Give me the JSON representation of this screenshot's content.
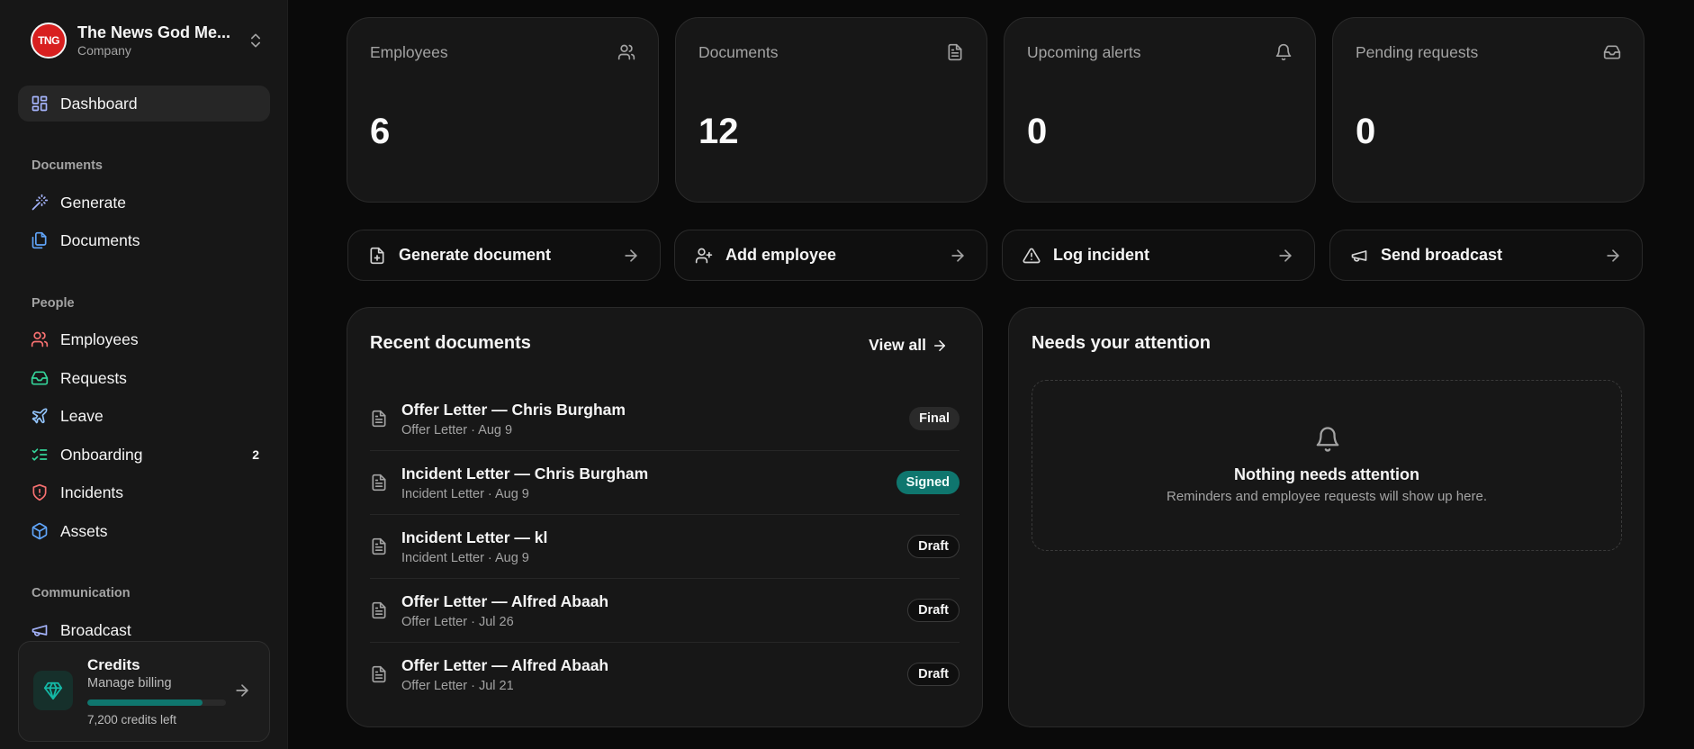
{
  "company": {
    "logo_text": "TNG",
    "name": "The News God Me...",
    "type": "Company"
  },
  "sidebar": {
    "active": {
      "label": "Dashboard",
      "icon": "layout-grid-icon"
    },
    "sections": [
      {
        "title": "Documents",
        "items": [
          {
            "label": "Generate",
            "icon": "magic-wand-icon",
            "color": "#a5b4fc"
          },
          {
            "label": "Documents",
            "icon": "files-icon",
            "color": "#60a5fa"
          }
        ]
      },
      {
        "title": "People",
        "items": [
          {
            "label": "Employees",
            "icon": "users-icon",
            "color": "#f87171"
          },
          {
            "label": "Requests",
            "icon": "inbox-icon",
            "color": "#34d399"
          },
          {
            "label": "Leave",
            "icon": "plane-icon",
            "color": "#93c5fd"
          },
          {
            "label": "Onboarding",
            "icon": "list-checks-icon",
            "color": "#34d399",
            "badge": "2"
          },
          {
            "label": "Incidents",
            "icon": "shield-alert-icon",
            "color": "#f87171"
          },
          {
            "label": "Assets",
            "icon": "box-icon",
            "color": "#60a5fa"
          }
        ]
      },
      {
        "title": "Communication",
        "items": [
          {
            "label": "Broadcast",
            "icon": "megaphone-icon",
            "color": "#a5b4fc"
          }
        ]
      }
    ]
  },
  "credits": {
    "title": "Credits",
    "subtitle": "Manage billing",
    "remaining": "7,200 credits left",
    "progress": 0.83
  },
  "stats": [
    {
      "label": "Employees",
      "value": "6",
      "icon": "users-icon"
    },
    {
      "label": "Documents",
      "value": "12",
      "icon": "file-text-icon"
    },
    {
      "label": "Upcoming alerts",
      "value": "0",
      "icon": "bell-icon"
    },
    {
      "label": "Pending requests",
      "value": "0",
      "icon": "inbox-icon"
    }
  ],
  "actions": [
    {
      "label": "Generate document",
      "icon": "file-plus-icon"
    },
    {
      "label": "Add employee",
      "icon": "user-plus-icon"
    },
    {
      "label": "Log incident",
      "icon": "alert-triangle-icon"
    },
    {
      "label": "Send broadcast",
      "icon": "megaphone-icon"
    }
  ],
  "recent": {
    "title": "Recent documents",
    "view_all": "View all",
    "items": [
      {
        "title": "Offer Letter — Chris Burgham",
        "meta": "Offer Letter · Aug 9",
        "status": "Final"
      },
      {
        "title": "Incident Letter — Chris Burgham",
        "meta": "Incident Letter · Aug 9",
        "status": "Signed"
      },
      {
        "title": "Incident Letter — kl",
        "meta": "Incident Letter · Aug 9",
        "status": "Draft"
      },
      {
        "title": "Offer Letter — Alfred Abaah",
        "meta": "Offer Letter · Jul 26",
        "status": "Draft"
      },
      {
        "title": "Offer Letter — Alfred Abaah",
        "meta": "Offer Letter · Jul 21",
        "status": "Draft"
      }
    ]
  },
  "attention": {
    "title": "Needs your attention",
    "empty_title": "Nothing needs attention",
    "empty_subtitle": "Reminders and employee requests will show up here."
  }
}
